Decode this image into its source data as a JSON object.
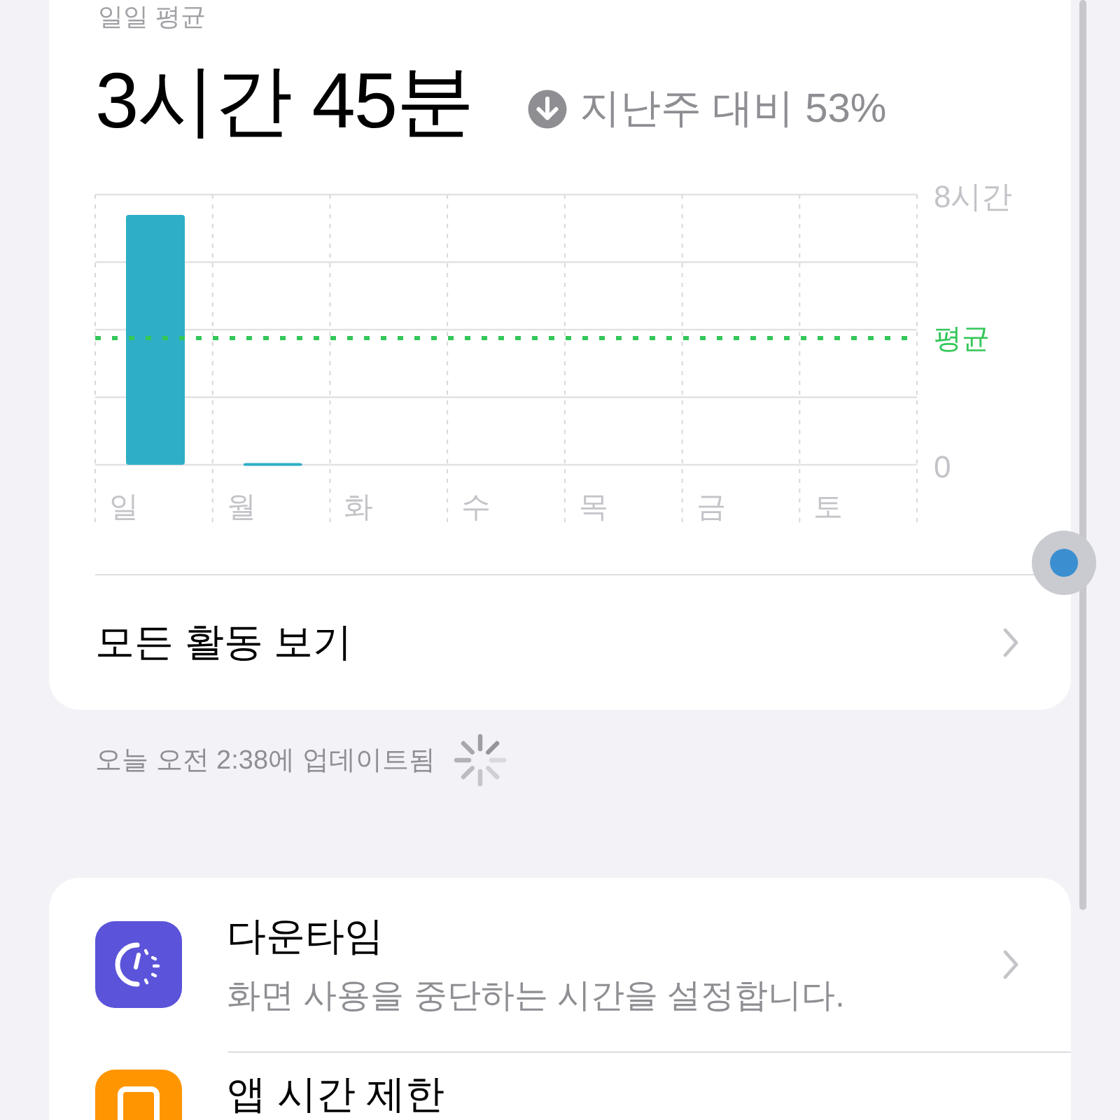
{
  "summary": {
    "label": "일일 평균",
    "total": "3시간 45분",
    "decreased": true,
    "trend": "지난주 대비 53%"
  },
  "chart_data": {
    "type": "bar",
    "categories": [
      "일",
      "월",
      "화",
      "수",
      "목",
      "금",
      "토"
    ],
    "values": [
      7.4,
      0.05,
      0,
      0,
      0,
      0,
      0
    ],
    "ylim": [
      0,
      8
    ],
    "yticks": [
      {
        "value": 0,
        "label": "0"
      },
      {
        "value": 8,
        "label": "8시간"
      }
    ],
    "ref_lines": [
      {
        "axis": "y",
        "value": 3.75,
        "label": "평균"
      }
    ]
  },
  "all_activity": {
    "label": "모든 활동 보기"
  },
  "updated": {
    "text": "오늘 오전 2:38에 업데이트됨",
    "loading": true
  },
  "settings": [
    {
      "kind": "downtime",
      "title": "다운타임",
      "subtitle": "화면 사용을 중단하는 시간을 설정합니다."
    },
    {
      "kind": "app_limits",
      "title": "앱 시간 제한"
    }
  ]
}
